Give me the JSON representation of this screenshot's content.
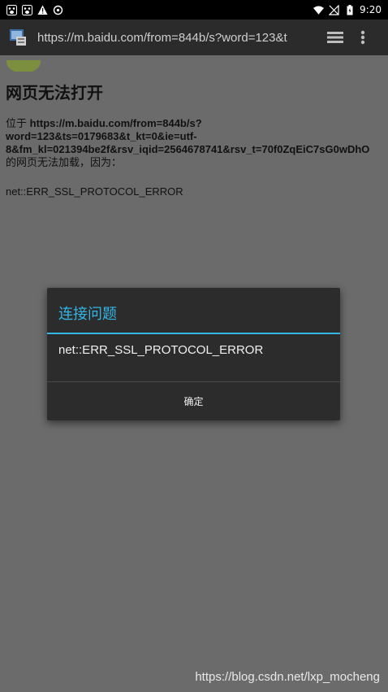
{
  "status_bar": {
    "time": "9:20",
    "left_icons": [
      "baidu-icon",
      "baidu-icon",
      "warning-icon",
      "sync-icon"
    ],
    "right_icons": [
      "wifi-icon",
      "no-signal-icon",
      "battery-icon"
    ]
  },
  "browser": {
    "url": "https://m.baidu.com/from=844b/s?word=123&t"
  },
  "page": {
    "title": "网页无法打开",
    "body_prefix": "位于",
    "body_url": "https://m.baidu.com/from=844b/s?\nword=123&ts=0179683&t_kt=0&ie=utf-\n8&fm_kl=021394be2f&rsv_iqid=2564678741&rsv_t=70f0ZqEiC7sG0wDhO",
    "body_suffix": "的网页无法加载，因为：",
    "error_code": "net::ERR_SSL_PROTOCOL_ERROR"
  },
  "dialog": {
    "title": "连接问题",
    "message": "net::ERR_SSL_PROTOCOL_ERROR",
    "ok_label": "确定",
    "accent_color": "#33b5e5"
  },
  "watermark": "https://blog.csdn.net/lxp_mocheng"
}
